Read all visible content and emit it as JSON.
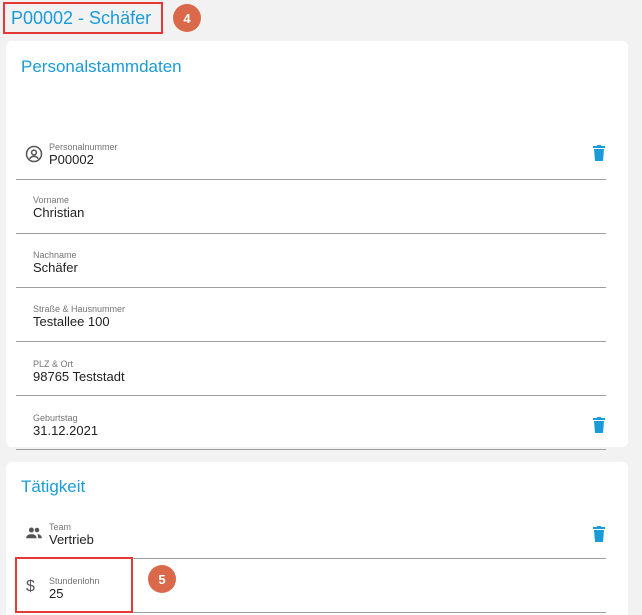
{
  "header": {
    "title": "P00002 - Schäfer",
    "badge": "4"
  },
  "personal": {
    "title": "Personalstammdaten",
    "fields": [
      {
        "label": "Personalnummer",
        "value": "P00002"
      },
      {
        "label": "Vorname",
        "value": "Christian"
      },
      {
        "label": "Nachname",
        "value": "Schäfer"
      },
      {
        "label": "Straße & Hausnummer",
        "value": "Testallee 100"
      },
      {
        "label": "PLZ & Ort",
        "value": "98765 Teststadt"
      },
      {
        "label": "Geburtstag",
        "value": "31.12.2021"
      }
    ]
  },
  "taetigkeit": {
    "title": "Tätigkeit",
    "fields": [
      {
        "label": "Team",
        "value": "Vertrieb"
      },
      {
        "label": "Stundenlohn",
        "value": "25"
      }
    ],
    "badge": "5"
  },
  "icons": {
    "personalnummer": "account-circle-icon",
    "team": "people-icon",
    "stundenlohn": "dollar-icon",
    "delete": "trash-icon"
  },
  "colors": {
    "accent": "#1a9bd7",
    "badge": "#d9694a",
    "highlight": "#e53935"
  }
}
